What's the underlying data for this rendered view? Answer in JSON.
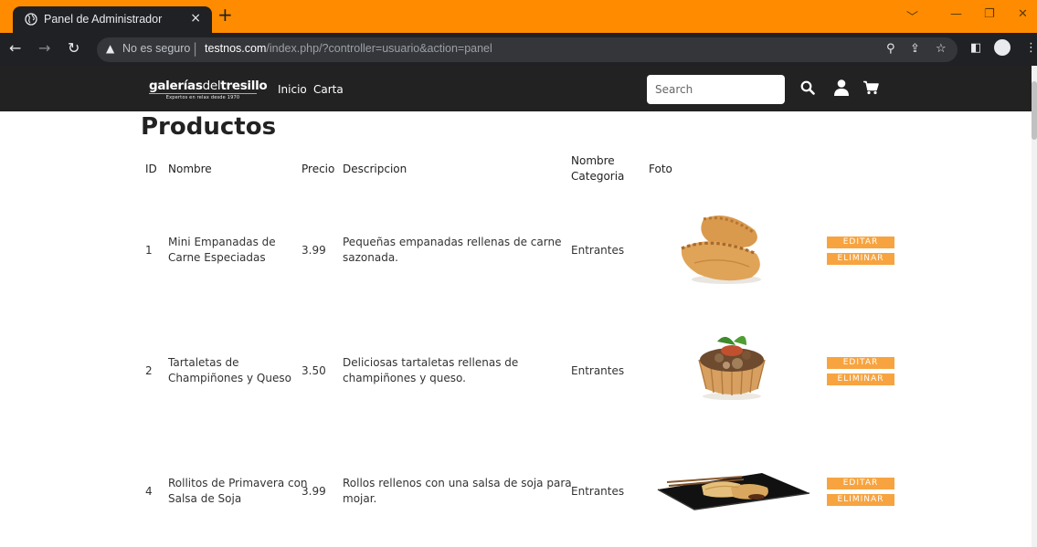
{
  "browser": {
    "tab_title": "Panel de Administrador",
    "tab_close": "×",
    "new_tab": "+",
    "security_label": "No es seguro",
    "url_host": "testnos.com",
    "url_path": "/index.php/?controller=usuario&action=panel"
  },
  "header": {
    "logo_brand_a": "galerías",
    "logo_brand_b": "del",
    "logo_brand_c": "tresillo",
    "logo_tagline": "Expertos en relax desde 1970",
    "nav": [
      "Inicio",
      "Carta"
    ],
    "search_placeholder": "Search"
  },
  "main": {
    "title": "Productos",
    "columns": {
      "id": "ID",
      "name": "Nombre",
      "price": "Precio",
      "description": "Descripcion",
      "category_line1": "Nombre",
      "category_line2": "Categoria",
      "photo": "Foto"
    },
    "edit_label": "EDITAR",
    "delete_label": "ELIMINAR",
    "rows": [
      {
        "id": "1",
        "name_line1": "Mini Empanadas de",
        "name_line2": "Carne Especiadas",
        "price": "3.99",
        "desc_line1": "Pequeñas empanadas rellenas de carne",
        "desc_line2": "sazonada.",
        "category": "Entrantes"
      },
      {
        "id": "2",
        "name_line1": "Tartaletas de",
        "name_line2": "Champiñones y Queso",
        "price": "3.50",
        "desc_line1": "Deliciosas tartaletas rellenas de",
        "desc_line2": "champiñones y queso.",
        "category": "Entrantes"
      },
      {
        "id": "4",
        "name_line1": "Rollitos de Primavera con",
        "name_line2": "Salsa de Soja",
        "price": "3.99",
        "desc_line1": "Rollos rellenos con una salsa de soja para",
        "desc_line2": "mojar.",
        "category": "Entrantes"
      }
    ]
  },
  "colors": {
    "tabbar": "#ff8c00",
    "header": "#222222",
    "button": "#f7a440"
  }
}
